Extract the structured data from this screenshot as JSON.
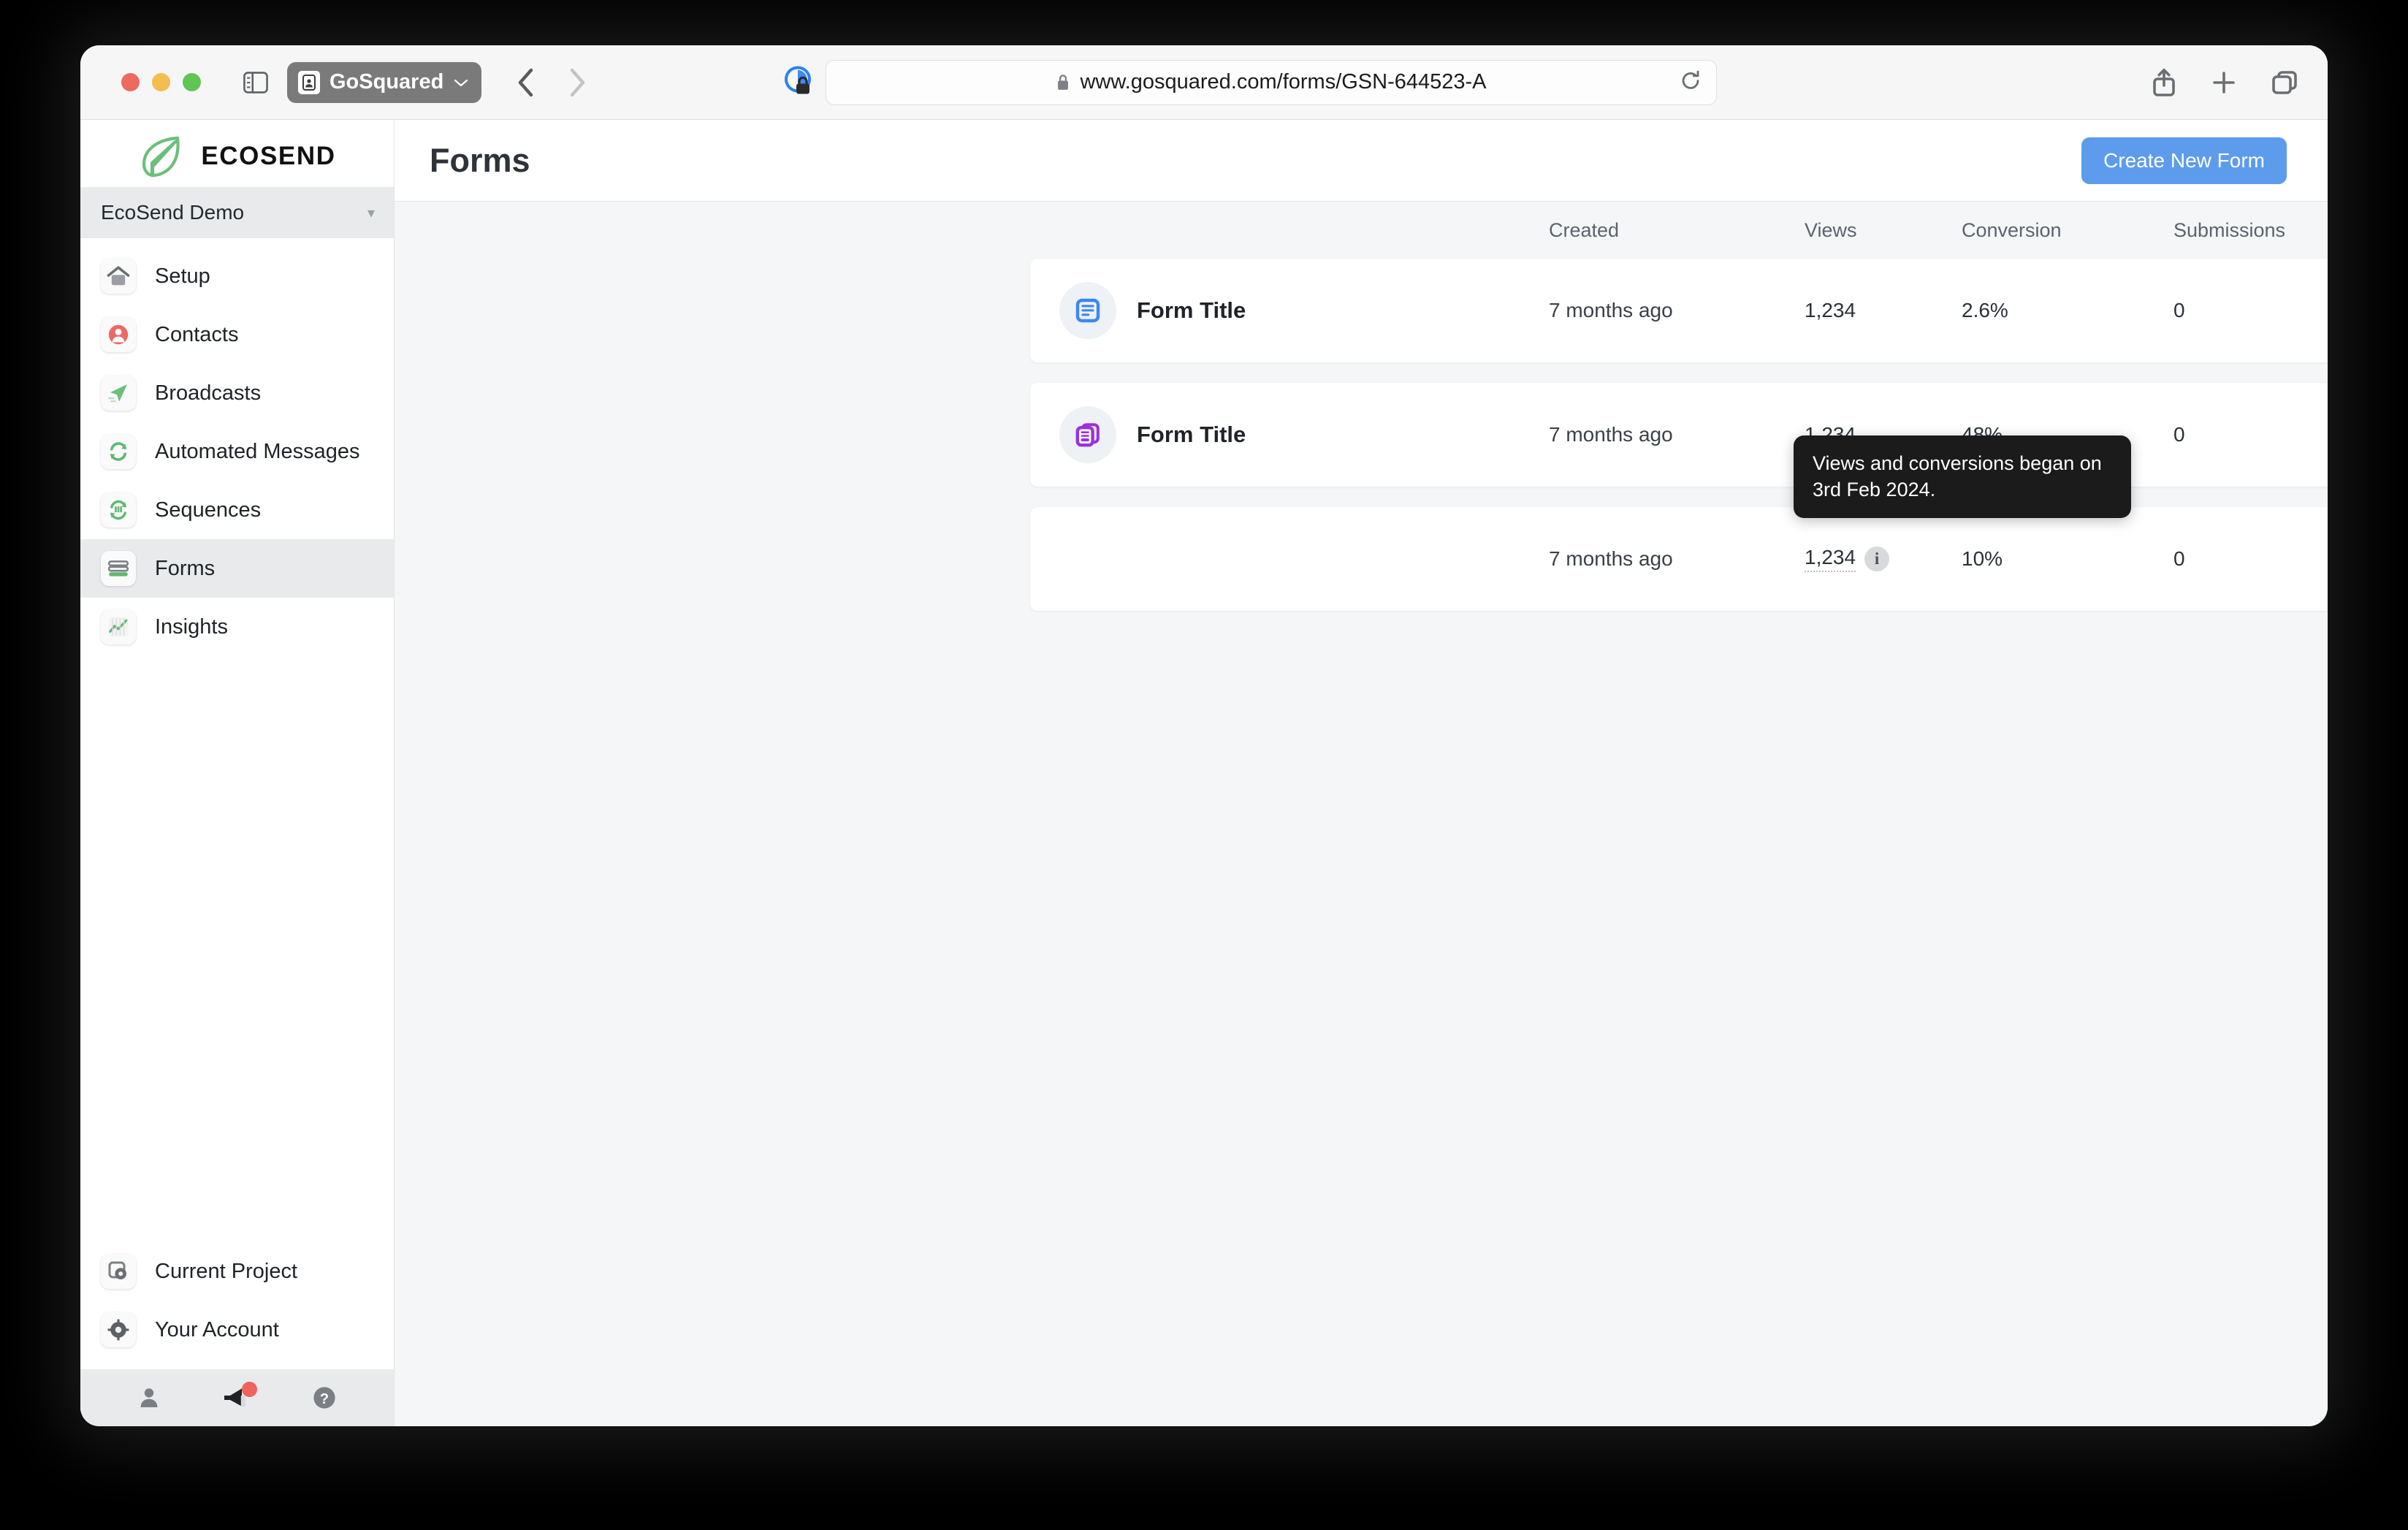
{
  "browser": {
    "tab_title": "GoSquared",
    "url": "www.gosquared.com/forms/GSN-644523-A",
    "icons": {
      "sidebar_toggle": "sidebar-toggle-icon",
      "back": "back-chevron-icon",
      "forward": "forward-chevron-icon",
      "reader": "reader-privacy-icon",
      "lock": "lock-icon",
      "reload": "reload-icon",
      "share": "share-icon",
      "new_tab": "plus-icon",
      "tab_overview": "tab-overview-icon"
    }
  },
  "sidebar": {
    "brand": "ECOSEND",
    "project": "EcoSend Demo",
    "items": [
      {
        "label": "Setup",
        "icon": "home-icon",
        "active": false
      },
      {
        "label": "Contacts",
        "icon": "contacts-icon",
        "active": false
      },
      {
        "label": "Broadcasts",
        "icon": "paper-plane-icon",
        "active": false
      },
      {
        "label": "Automated Messages",
        "icon": "automation-loop-icon",
        "active": false
      },
      {
        "label": "Sequences",
        "icon": "sequences-icon",
        "active": false
      },
      {
        "label": "Forms",
        "icon": "forms-icon",
        "active": true
      },
      {
        "label": "Insights",
        "icon": "chart-line-icon",
        "active": false
      }
    ],
    "bottom_items": [
      {
        "label": "Current Project",
        "icon": "project-gear-icon"
      },
      {
        "label": "Your Account",
        "icon": "gear-icon"
      }
    ],
    "bottom_bar": [
      {
        "icon": "person-icon",
        "badge": false
      },
      {
        "icon": "megaphone-icon",
        "badge": true
      },
      {
        "icon": "help-question-icon",
        "badge": false
      }
    ]
  },
  "header": {
    "title": "Forms",
    "create_button": "Create New Form"
  },
  "table": {
    "columns": {
      "title": "",
      "created": "Created",
      "views": "Views",
      "conversion": "Conversion",
      "submissions": "Submissions"
    },
    "rows": [
      {
        "icon": "form-inline-icon",
        "icon_color": "#3d86f5",
        "title": "Form Title",
        "created": "7 months ago",
        "views": "1,234",
        "has_info": false,
        "conversion": "2.6%",
        "submissions": "0",
        "arrow": "arrow-right-icon"
      },
      {
        "icon": "form-popup-icon",
        "icon_color": "#9b30e0",
        "title": "Form Title",
        "created": "7 months ago",
        "views": "1,234",
        "has_info": false,
        "conversion": "48%",
        "submissions": "0",
        "arrow": "arrow-right-icon"
      },
      {
        "icon": "",
        "icon_color": "",
        "title": "",
        "created": "7 months ago",
        "views": "1,234",
        "has_info": true,
        "conversion": "10%",
        "submissions": "0",
        "arrow": "arrow-right-icon"
      }
    ]
  },
  "tooltip": {
    "text": "Views and conversions began on 3rd Feb 2024."
  },
  "colors": {
    "accent_blue": "#5d9cec",
    "brand_green": "#6bbf7b",
    "tooltip_bg": "#1b1b1b",
    "sidebar_active": "#e8eaec",
    "page_bg": "#f5f6f8"
  }
}
